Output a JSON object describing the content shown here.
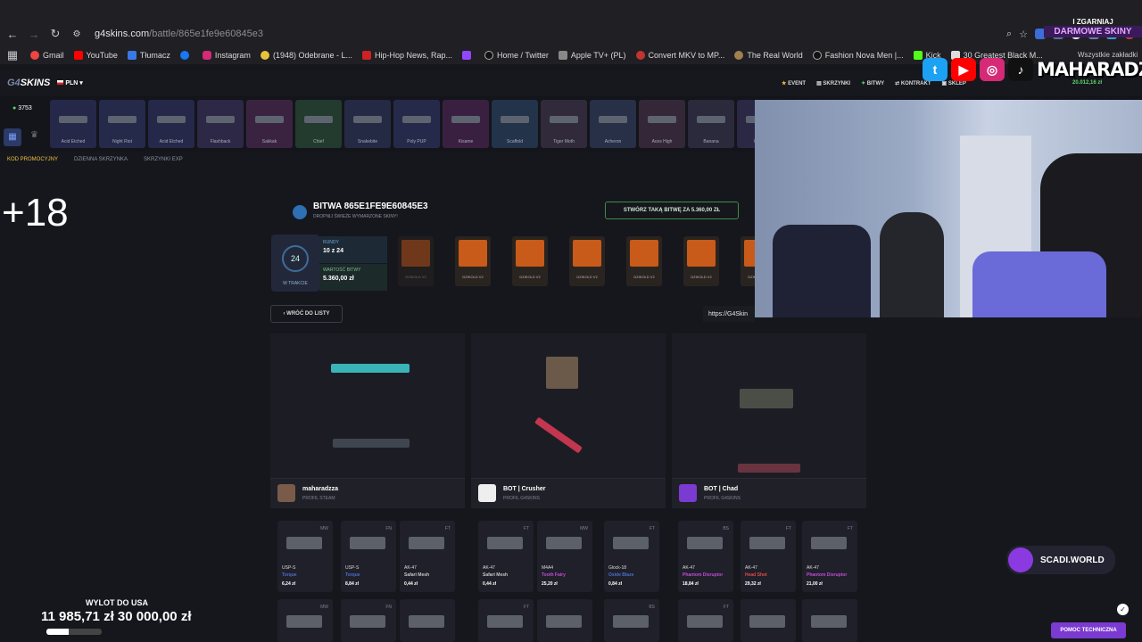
{
  "browser": {
    "url_host": "g4skins.com",
    "url_path": "/battle/865e1fe9e60845e3",
    "all_bookmarks_label": "Wszystkie zakładki",
    "bookmarks": [
      "Gmail",
      "YouTube",
      "Tłumacz",
      "",
      "Instagram",
      "(1948) Odebrane - L...",
      "Hip-Hop News, Rap...",
      "",
      "Home / Twitter",
      "Apple TV+ (PL)",
      "Convert MKV to MP...",
      "The Real World",
      "Fashion Nova Men |...",
      "Kick",
      "30 Greatest Black M..."
    ]
  },
  "site": {
    "logo_main": "G4",
    "logo_rest": "SKINS",
    "currency": "PLN",
    "nav": [
      "EVENT",
      "SKRZYNKI",
      "BITWY",
      "KONTRAKT",
      "SKLEP"
    ],
    "balance": "20.012,16 zł",
    "level": "3753",
    "subnav": [
      "KOD PROMOCYJNY",
      "DZIENNA SKRZYNKA",
      "SKRZYNKI EXP"
    ]
  },
  "cases": [
    "Acid Etched",
    "Night Riot",
    "Acid Etched",
    "Flashback",
    "Sakkak",
    "Chief",
    "Snakebite",
    "Poly PUP",
    "Kisame",
    "Scaffold",
    "Tiger Moth",
    "Acheron",
    "Aces High",
    "Banana",
    "Condu"
  ],
  "battle": {
    "title": "BITWA 865E1FE9E60845E3",
    "subtitle": "DROPNIJ ŚWIEŻE WYMARZONE SKINY!",
    "create_button": "STWÓRZ TAKĄ BITWĘ ZA 5.360,00 ZŁ",
    "status_number": "24",
    "status_label": "W TRAKCIE",
    "rounds_label": "RUNDY",
    "rounds_value": "10 z 24",
    "value_label": "WARTOŚĆ BITWY",
    "value_value": "5.360,00 zł",
    "slots": [
      "DZIKOLD V2",
      "DZIKOLD V2",
      "DZIKOLD V2",
      "DZIKOLD V2",
      "DZIKOLD V2",
      "DZIKOLD V2",
      "DZIKOLD V2"
    ],
    "back_button": "WRÓĆ DO LISTY",
    "link_value": "https://G4Skin"
  },
  "players": [
    {
      "name": "maharadzza",
      "sub": "PROFIL STEAM"
    },
    {
      "name": "BOT | Crusher",
      "sub": "PROFIL G4SKINS"
    },
    {
      "name": "BOT | Chad",
      "sub": "PROFIL G4SKINS"
    }
  ],
  "items": [
    {
      "wear": "MW",
      "name": "USP-S",
      "skin": "Torque",
      "price": "6,24 zł",
      "color": "#4a6fd0"
    },
    {
      "wear": "FN",
      "name": "USP-S",
      "skin": "Torque",
      "price": "8,84 zł",
      "color": "#4a6fd0"
    },
    {
      "wear": "FT",
      "name": "AK-47",
      "skin": "Safari Mesh",
      "price": "0,44 zł",
      "color": "#c7c7c7"
    },
    {
      "wear": "FT",
      "name": "AK-47",
      "skin": "Safari Mesh",
      "price": "0,44 zł",
      "color": "#c7c7c7"
    },
    {
      "wear": "MW",
      "name": "M4A4",
      "skin": "Tooth Fairy",
      "price": "25,20 zł",
      "color": "#c24bd8"
    },
    {
      "wear": "FT",
      "name": "Glock-18",
      "skin": "Oxide Blaze",
      "price": "0,84 zł",
      "color": "#4a6fd0"
    },
    {
      "wear": "BS",
      "name": "AK-47",
      "skin": "Phantom Disruptor",
      "price": "18,84 zł",
      "color": "#c24bd8"
    },
    {
      "wear": "FT",
      "name": "AK-47",
      "skin": "Head Shot",
      "price": "29,32 zł",
      "color": "#e04a4a"
    },
    {
      "wear": "FT",
      "name": "AK-47",
      "skin": "Phantom Disruptor",
      "price": "21,00 zł",
      "color": "#c24bd8"
    }
  ],
  "row2_wear": [
    "MW",
    "FN",
    "",
    "FT",
    "",
    "BS",
    "FT",
    "",
    ""
  ],
  "overlay": {
    "plus18": "+18",
    "top_line1": "I ZGARNIAJ",
    "top_line2": "DARMOWE SKINY",
    "streamer": "MAHARADZZA",
    "scadi": "SCADI.WORLD",
    "help": "POMOC TECHNICZNA",
    "goal_label": "WYLOT DO USA",
    "goal_current": "11 985,71 zł",
    "goal_target": "30 000,00 zł",
    "goal_progress": 0.4
  }
}
